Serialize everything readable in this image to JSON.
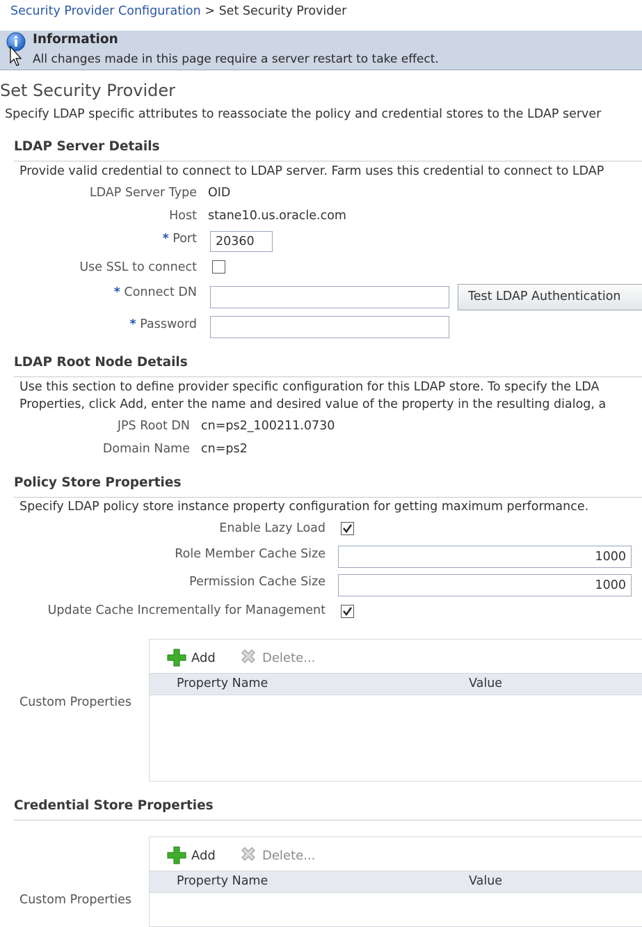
{
  "breadcrumb": {
    "link": "Security Provider Configuration",
    "separator": ">",
    "current": "Set Security Provider"
  },
  "info": {
    "icon": "info-icon",
    "title": "Information",
    "message": "All changes made in this page require a server restart to take effect."
  },
  "page": {
    "title": "Set Security Provider",
    "description": "Specify LDAP specific attributes to reassociate the policy and credential stores to the LDAP server"
  },
  "ldap_server": {
    "heading": "LDAP Server Details",
    "description": "Provide valid credential to connect to LDAP server. Farm uses this credential to connect to LDAP",
    "server_type_label": "LDAP Server Type",
    "server_type_value": "OID",
    "host_label": "Host",
    "host_value": "stane10.us.oracle.com",
    "required_marker": "*",
    "port_label": "Port",
    "port_value": "20360",
    "ssl_label": "Use SSL to connect",
    "ssl_checked": false,
    "connect_dn_label": "Connect DN",
    "connect_dn_value": "",
    "password_label": "Password",
    "password_value": "",
    "test_button": "Test LDAP Authentication"
  },
  "root_node": {
    "heading": "LDAP Root Node Details",
    "description_line1": "Use this section to define provider specific configuration for this LDAP store. To specify the LDA",
    "description_line2": "Properties, click Add, enter the name and desired value of the property in the resulting dialog, a",
    "jps_root_label": "JPS Root DN",
    "jps_root_value": "cn=ps2_100211.0730",
    "domain_label": "Domain Name",
    "domain_value": "cn=ps2"
  },
  "policy_store": {
    "heading": "Policy Store Properties",
    "description": "Specify LDAP policy store instance property configuration for getting maximum performance.",
    "lazy_load_label": "Enable Lazy Load",
    "lazy_load_checked": true,
    "role_cache_label": "Role Member Cache Size",
    "role_cache_value": "1000",
    "perm_cache_label": "Permission Cache Size",
    "perm_cache_value": "1000",
    "update_cache_label": "Update Cache Incrementally for Management",
    "update_cache_checked": true,
    "custom_label": "Custom Properties",
    "add_label": "Add",
    "delete_label": "Delete...",
    "col_name": "Property Name",
    "col_value": "Value"
  },
  "credential_store": {
    "heading": "Credential Store Properties",
    "custom_label": "Custom Properties",
    "add_label": "Add",
    "delete_label": "Delete...",
    "col_name": "Property Name",
    "col_value": "Value"
  },
  "colors": {
    "link": "#2b58a6",
    "info_bg": "#ccd6e4",
    "required": "#2458b0",
    "add_icon": "#3fae2a"
  }
}
